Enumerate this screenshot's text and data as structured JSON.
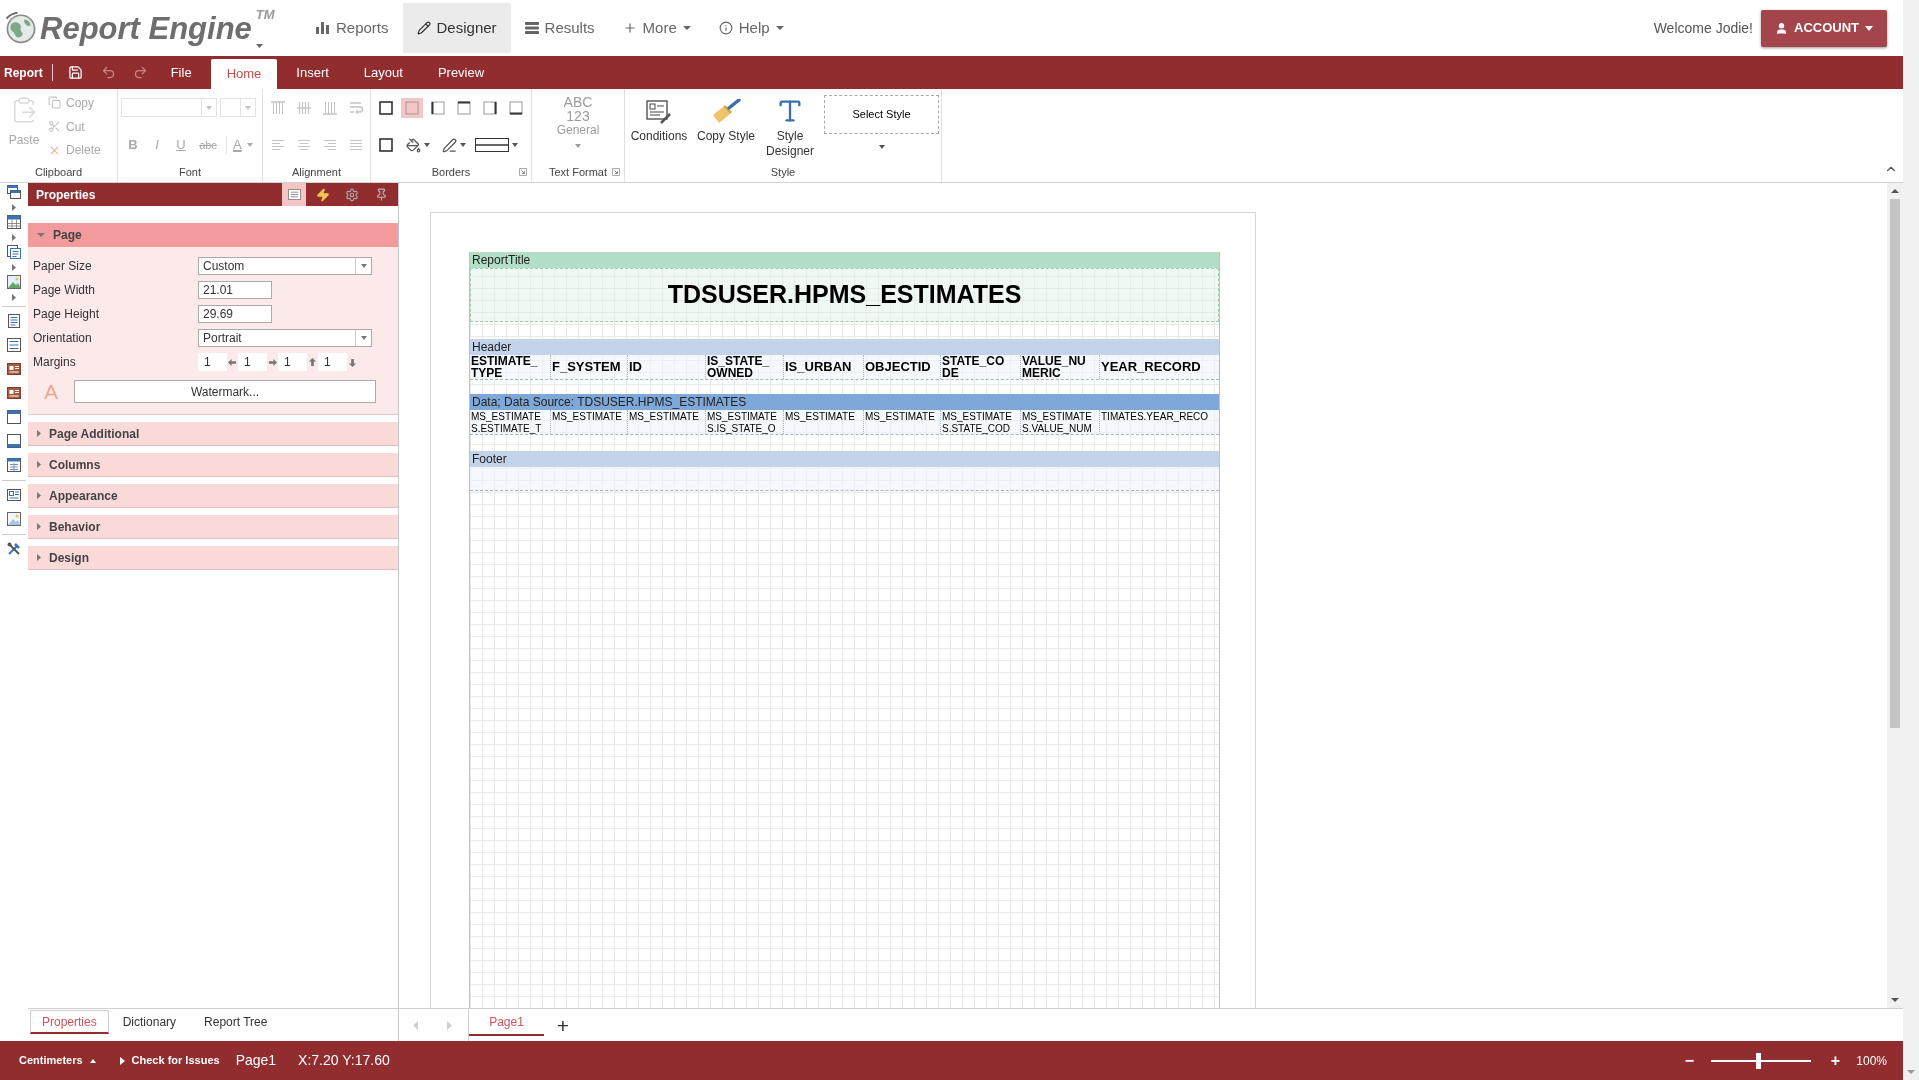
{
  "header": {
    "logo": {
      "name": "Report Engine",
      "trademark": "TM"
    },
    "nav": [
      {
        "label": "Reports",
        "selected": false,
        "dropdown": false
      },
      {
        "label": "Designer",
        "selected": true,
        "dropdown": false
      },
      {
        "label": "Results",
        "selected": false,
        "dropdown": false
      },
      {
        "label": "More",
        "selected": false,
        "dropdown": true
      },
      {
        "label": "Help",
        "selected": false,
        "dropdown": true
      }
    ],
    "welcome": "Welcome Jodie!",
    "account_button": "ACCOUNT"
  },
  "ribbon_tabs": {
    "title": "Report",
    "undo": {
      "disabled": true
    },
    "redo": {
      "disabled": true
    },
    "tabs": [
      {
        "label": "File",
        "selected": false
      },
      {
        "label": "Home",
        "selected": true
      },
      {
        "label": "Insert",
        "selected": false
      },
      {
        "label": "Layout",
        "selected": false
      },
      {
        "label": "Preview",
        "selected": false
      }
    ]
  },
  "ribbon": {
    "groups": [
      {
        "kind": "clipboard",
        "label": "Clipboard",
        "disabled": true,
        "paste": "Paste",
        "items": [
          "Copy",
          "Cut",
          "Delete"
        ]
      },
      {
        "kind": "font",
        "label": "Font",
        "disabled": true,
        "buttons": [
          {
            "kind": "bold",
            "label": "B"
          },
          {
            "kind": "italic",
            "label": "I"
          },
          {
            "kind": "underline",
            "label": "U"
          },
          {
            "kind": "strike",
            "label": "abc"
          },
          {
            "kind": "color",
            "label": "A"
          }
        ]
      },
      {
        "kind": "alignment",
        "label": "Alignment",
        "disabled": true
      },
      {
        "kind": "borders",
        "label": "Borders",
        "border_buttons": [
          {
            "selected": false
          },
          {
            "selected": true
          },
          {
            "selected": false
          },
          {
            "selected": false
          },
          {
            "selected": false
          },
          {
            "selected": false
          }
        ]
      },
      {
        "kind": "text_format",
        "label": "Text Format",
        "disabled": true,
        "letters": "ABC",
        "digits": "123",
        "format": "General"
      },
      {
        "kind": "style",
        "label": "Style",
        "buttons": [
          "Conditions",
          "Copy Style",
          "Style Designer"
        ],
        "select_style": "Select Style"
      }
    ]
  },
  "properties_panel": {
    "title": "Properties",
    "toolbar": [
      {
        "selected": true
      },
      {
        "selected": false
      },
      {
        "selected": false
      },
      {
        "selected": false
      }
    ],
    "sections": [
      {
        "label": "Page",
        "expanded": true,
        "fields": [
          {
            "kind": "select",
            "label": "Paper Size",
            "value": "Custom"
          },
          {
            "kind": "input",
            "label": "Page Width",
            "value": "21.01"
          },
          {
            "kind": "input",
            "label": "Page Height",
            "value": "29.69"
          },
          {
            "kind": "select",
            "label": "Orientation",
            "value": "Portrait"
          },
          {
            "kind": "margins",
            "label": "Margins",
            "values": [
              "1",
              "1",
              "1",
              "1"
            ]
          }
        ],
        "watermark_glyph": "A",
        "watermark_button": "Watermark..."
      },
      {
        "label": "Page Additional",
        "expanded": false
      },
      {
        "label": "Columns",
        "expanded": false
      },
      {
        "label": "Appearance",
        "expanded": false
      },
      {
        "label": "Behavior",
        "expanded": false
      },
      {
        "label": "Design",
        "expanded": false
      }
    ],
    "tabs": [
      {
        "label": "Properties",
        "selected": true
      },
      {
        "label": "Dictionary",
        "selected": false
      },
      {
        "label": "Report Tree",
        "selected": false
      }
    ]
  },
  "designer": {
    "bands": [
      {
        "kind": "title",
        "label": "ReportTitle",
        "title": "TDSUSER.HPMS_ESTIMATES"
      },
      {
        "kind": "header",
        "label": "Header",
        "cells": [
          {
            "lines": [
              "ESTIMATE_",
              "TYPE"
            ]
          },
          {
            "lines": [
              "F_SYSTEM"
            ]
          },
          {
            "lines": [
              "ID"
            ]
          },
          {
            "lines": [
              "IS_STATE_",
              "OWNED"
            ]
          },
          {
            "lines": [
              "IS_URBAN"
            ]
          },
          {
            "lines": [
              "OBJECTID"
            ]
          },
          {
            "lines": [
              "STATE_CO",
              "DE"
            ]
          },
          {
            "lines": [
              "VALUE_NU",
              "MERIC"
            ]
          },
          {
            "lines": [
              "YEAR_RECORD"
            ]
          }
        ]
      },
      {
        "kind": "data",
        "label": "Data; Data Source: TDSUSER.HPMS_ESTIMATES",
        "cells": [
          {
            "lines": [
              "MS_ESTIMATE",
              "S.ESTIMATE_T"
            ]
          },
          {
            "lines": [
              "MS_ESTIMATE"
            ]
          },
          {
            "lines": [
              "MS_ESTIMATE"
            ]
          },
          {
            "lines": [
              "MS_ESTIMATE",
              "S.IS_STATE_O"
            ]
          },
          {
            "lines": [
              "MS_ESTIMATE"
            ]
          },
          {
            "lines": [
              "MS_ESTIMATE"
            ]
          },
          {
            "lines": [
              "MS_ESTIMATE",
              "S.STATE_COD"
            ]
          },
          {
            "lines": [
              "MS_ESTIMATE",
              "S.VALUE_NUM"
            ]
          },
          {
            "lines": [
              "TIMATES.YEAR_RECO"
            ]
          }
        ]
      },
      {
        "kind": "footer",
        "label": "Footer"
      }
    ],
    "page_tabs": [
      {
        "label": "Page1",
        "selected": true
      }
    ],
    "add_page": "+"
  },
  "status_bar": {
    "units": "Centimeters",
    "check": "Check for Issues",
    "page": "Page1",
    "position": "X:7.20 Y:17.60",
    "zoom_out": "−",
    "zoom": {
      "level": 0.47
    },
    "zoom_in": "+",
    "zoom_reading": "100%"
  }
}
